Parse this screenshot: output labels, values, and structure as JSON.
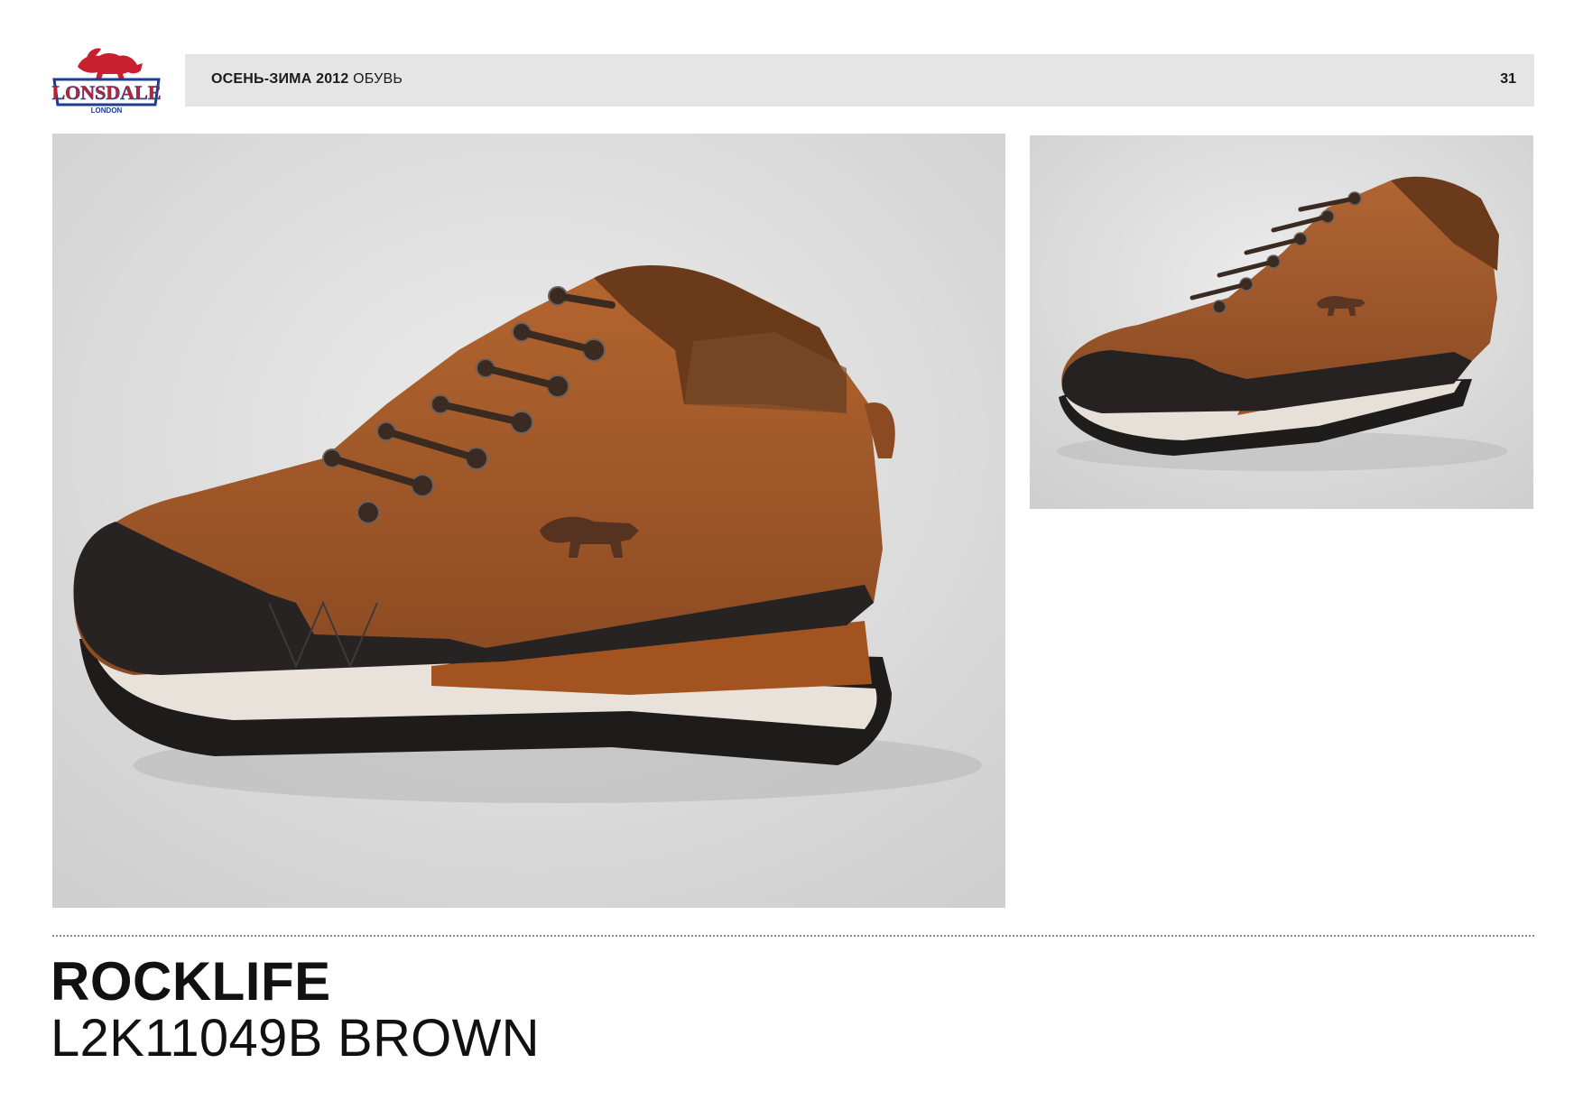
{
  "brand": {
    "logo_text": "LONSDALE",
    "logo_subtext": "LONDON",
    "colors": {
      "red": "#c8202e",
      "blue": "#1d3d8f"
    }
  },
  "header": {
    "season": "ОСЕНЬ-ЗИМА 2012",
    "category": "ОБУВЬ",
    "page_number": "31"
  },
  "product": {
    "name": "ROCKLIFE",
    "code": "L2K11049B BROWN"
  },
  "images": {
    "main": {
      "subject": "brown-leather-sneaker-side-view"
    },
    "side": {
      "subject": "brown-leather-sneaker-front-angle-view"
    }
  }
}
